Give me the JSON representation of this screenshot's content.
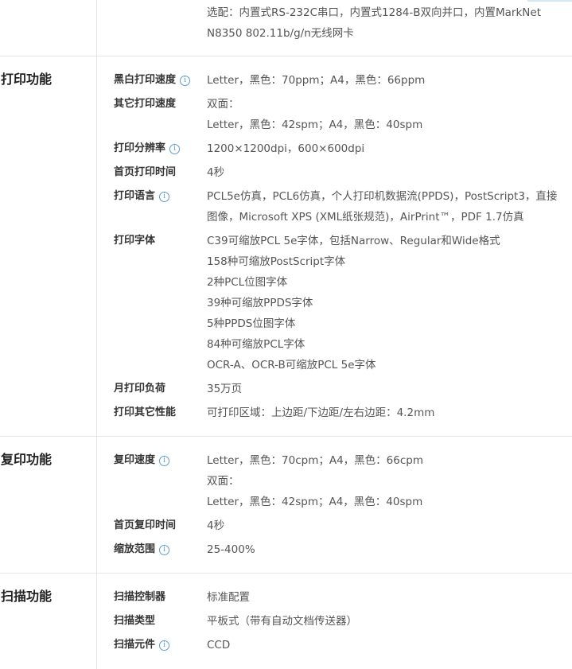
{
  "top": {
    "value_lines": [
      "选配：内置式RS-232C串口，内置式1284-B双向并口，内置MarkNet N8350 802.11b/g/n无线网卡"
    ]
  },
  "print": {
    "title": "打印功能",
    "rows": [
      {
        "label": "黑白打印速度",
        "info": true,
        "lines": [
          "Letter，黑色：70ppm；A4，黑色：66ppm"
        ]
      },
      {
        "label": "其它打印速度",
        "info": false,
        "lines": [
          "双面：",
          "Letter，黑色：42spm；A4，黑色：40spm"
        ]
      },
      {
        "label": "打印分辨率",
        "info": true,
        "lines": [
          "1200×1200dpi，600×600dpi"
        ]
      },
      {
        "label": "首页打印时间",
        "info": false,
        "lines": [
          "4秒"
        ]
      },
      {
        "label": "打印语言",
        "info": true,
        "lines": [
          "PCL5e仿真，PCL6仿真，个人打印机数据流(PPDS)，PostScript3，直接图像，Microsoft XPS (XML纸张规范)，AirPrint™，PDF 1.7仿真"
        ]
      },
      {
        "label": "打印字体",
        "info": false,
        "lines": [
          "C39可缩放PCL 5e字体，包括Narrow、Regular和Wide格式",
          "158种可缩放PostScript字体",
          "2种PCL位图字体",
          "39种可缩放PPDS字体",
          "5种PPDS位图字体",
          "84种可缩放PCL字体",
          "OCR-A、OCR-B可缩放PCL 5e字体"
        ]
      },
      {
        "label": "月打印负荷",
        "info": false,
        "lines": [
          "35万页"
        ]
      },
      {
        "label": "打印其它性能",
        "info": false,
        "lines": [
          "可打印区域：上边距/下边距/左右边距：4.2mm"
        ]
      }
    ]
  },
  "copy": {
    "title": "复印功能",
    "rows": [
      {
        "label": "复印速度",
        "info": true,
        "lines": [
          "Letter，黑色：70cpm；A4，黑色：66cpm",
          "双面：",
          "Letter，黑色：42spm；A4，黑色：40spm"
        ]
      },
      {
        "label": "首页复印时间",
        "info": false,
        "lines": [
          "4秒"
        ]
      },
      {
        "label": "缩放范围",
        "info": true,
        "lines": [
          "25-400%"
        ]
      }
    ]
  },
  "scan": {
    "title": "扫描功能",
    "rows": [
      {
        "label": "扫描控制器",
        "info": false,
        "lines": [
          "标准配置"
        ]
      },
      {
        "label": "扫描类型",
        "info": false,
        "lines": [
          "平板式（带有自动文档传送器）"
        ]
      },
      {
        "label": "扫描元件",
        "info": true,
        "lines": [
          "CCD"
        ]
      }
    ]
  },
  "icons": {
    "info": "info-circle-icon"
  },
  "colors": {
    "info": "#5b9bd5",
    "border": "#e6e6e6"
  }
}
